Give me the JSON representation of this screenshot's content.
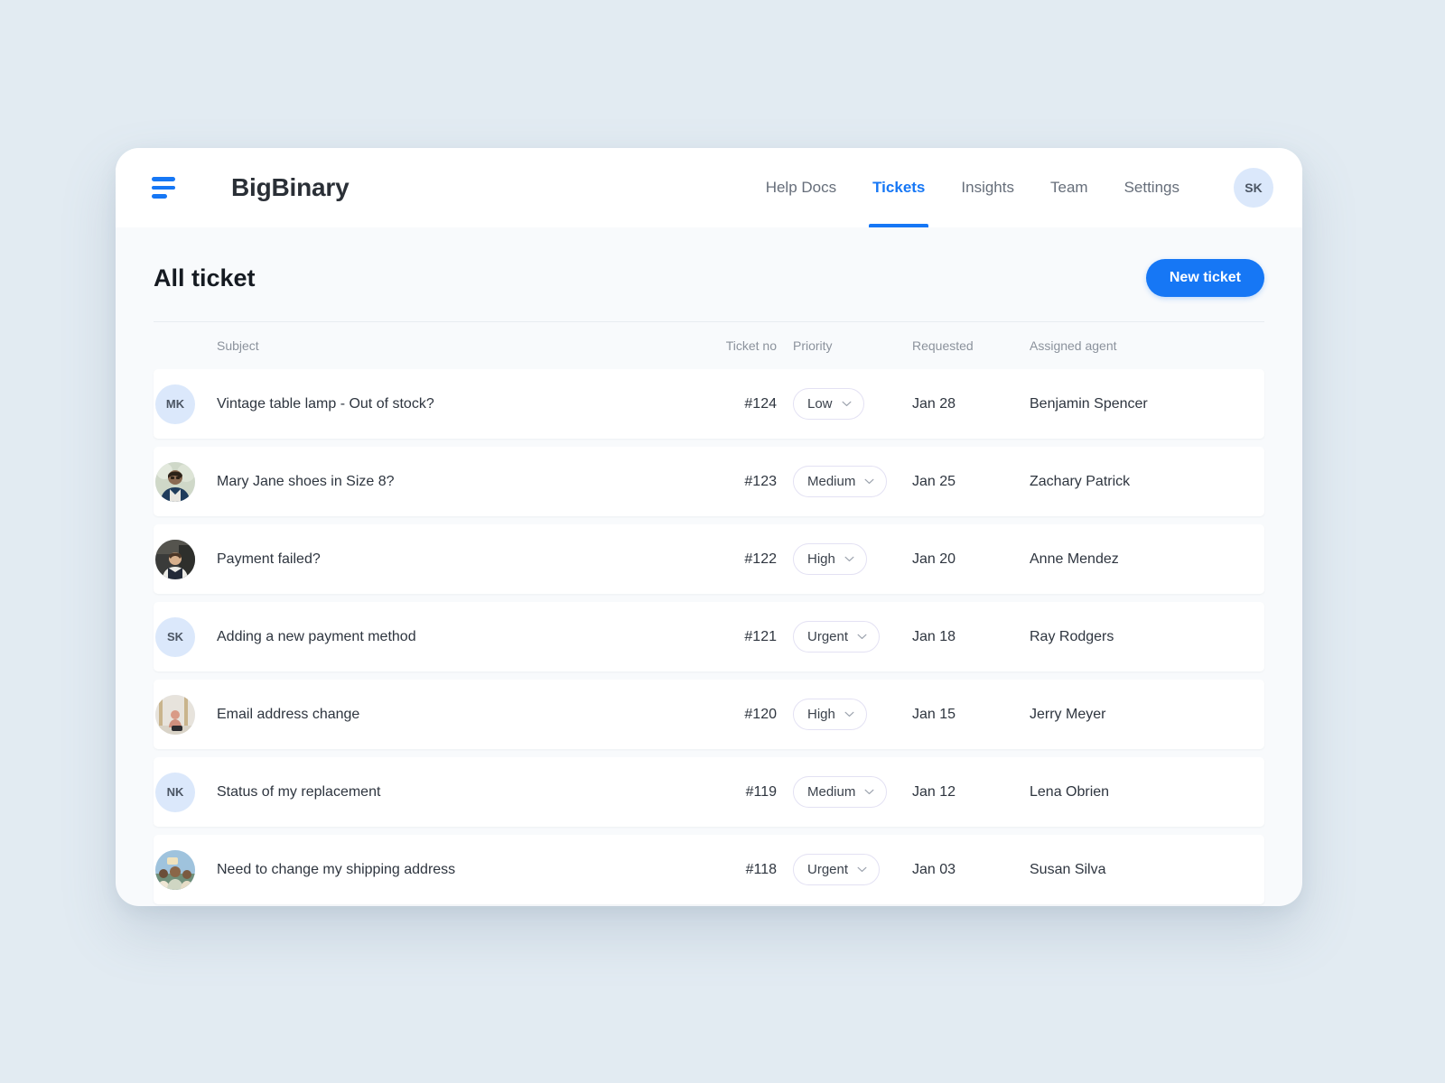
{
  "window": {
    "brand": "BigBinary",
    "menu_icon": "hamburger-icon"
  },
  "nav": {
    "items": [
      {
        "label": "Help Docs",
        "active": false
      },
      {
        "label": "Tickets",
        "active": true
      },
      {
        "label": "Insights",
        "active": false
      },
      {
        "label": "Team",
        "active": false
      },
      {
        "label": "Settings",
        "active": false
      }
    ],
    "user_avatar_initials": "SK"
  },
  "page": {
    "title": "All ticket",
    "new_ticket_label": "New ticket"
  },
  "table": {
    "columns": [
      "Subject",
      "Ticket no",
      "Priority",
      "Requested",
      "Assigned agent"
    ],
    "rows": [
      {
        "avatar_type": "initials",
        "avatar": "MK",
        "subject": "Vintage table lamp - Out of stock?",
        "ticket_no": "#124",
        "priority": "Low",
        "requested": "Jan 28",
        "agent": "Benjamin Spencer"
      },
      {
        "avatar_type": "photo",
        "avatar": "photo-man-glasses-blue-jacket",
        "subject": "Mary Jane shoes in Size 8?",
        "ticket_no": "#123",
        "priority": "Medium",
        "requested": "Jan 25",
        "agent": "Zachary Patrick"
      },
      {
        "avatar_type": "photo",
        "avatar": "photo-person-dark-vest",
        "subject": "Payment failed?",
        "ticket_no": "#122",
        "priority": "High",
        "requested": "Jan 20",
        "agent": "Anne Mendez"
      },
      {
        "avatar_type": "initials",
        "avatar": "SK",
        "subject": "Adding a new payment method",
        "ticket_no": "#121",
        "priority": "Urgent",
        "requested": "Jan 18",
        "agent": "Ray Rodgers"
      },
      {
        "avatar_type": "photo",
        "avatar": "photo-person-seated-beige",
        "subject": "Email address change",
        "ticket_no": "#120",
        "priority": "High",
        "requested": "Jan 15",
        "agent": "Jerry Meyer"
      },
      {
        "avatar_type": "initials",
        "avatar": "NK",
        "subject": "Status of my replacement",
        "ticket_no": "#119",
        "priority": "Medium",
        "requested": "Jan 12",
        "agent": "Lena Obrien"
      },
      {
        "avatar_type": "photo",
        "avatar": "photo-group-outdoors",
        "subject": "Need to change my shipping address",
        "ticket_no": "#118",
        "priority": "Urgent",
        "requested": "Jan 03",
        "agent": "Susan Silva"
      }
    ],
    "priority_options": [
      "Low",
      "Medium",
      "High",
      "Urgent"
    ]
  },
  "colors": {
    "accent": "#1677f5",
    "page_background": "#e2ebf2",
    "app_background": "#f8fafc",
    "card": "#ffffff",
    "avatar_placeholder": "#dbe8fb",
    "text": "#2e353f",
    "muted_text": "#8b929c"
  }
}
